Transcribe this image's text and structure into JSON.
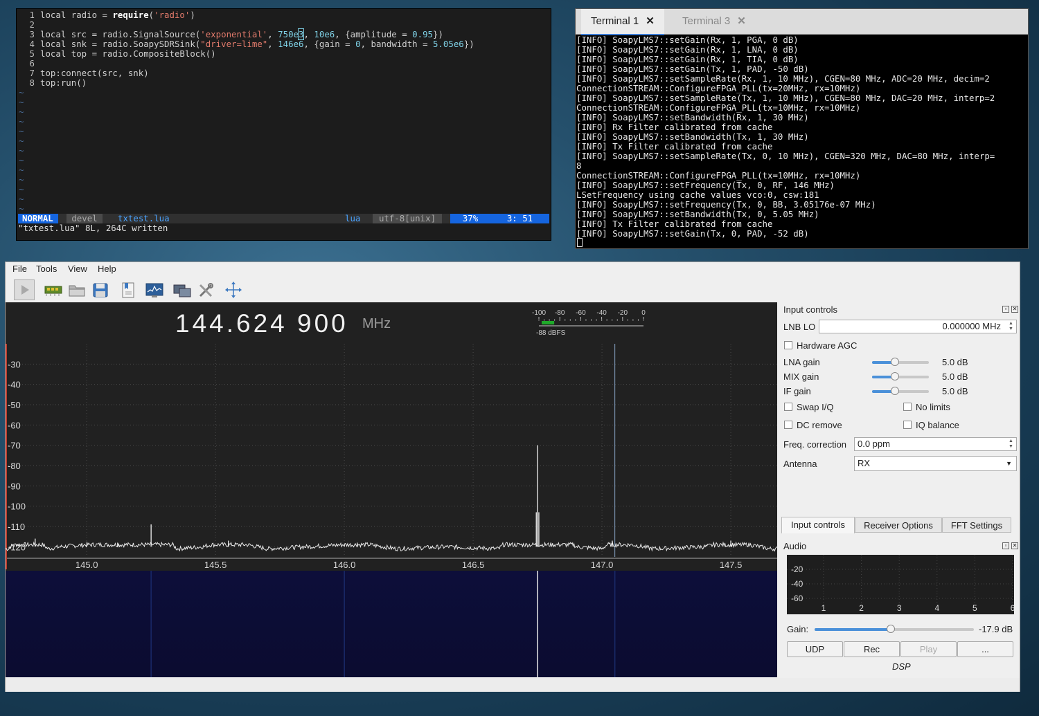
{
  "editor": {
    "lines": [
      {
        "n": "1"
      },
      {
        "n": "2"
      },
      {
        "n": "3"
      },
      {
        "n": "4"
      },
      {
        "n": "5"
      },
      {
        "n": "6"
      },
      {
        "n": "7"
      },
      {
        "n": "8"
      }
    ],
    "code": {
      "l1a": "local radio = ",
      "l1b": "require",
      "l1c": "(",
      "l1d": "'radio'",
      "l1e": ")",
      "l3a": "local src = radio.SignalSource(",
      "l3b": "'exponential'",
      "l3c": ", ",
      "l3d": "750e",
      "l3e": "3",
      "l3f": ", ",
      "l3g": "10e6",
      "l3h": ", {amplitude = ",
      "l3i": "0.95",
      "l3j": "})",
      "l4a": "local snk = radio.SoapySDRSink(",
      "l4b": "\"driver=lime\"",
      "l4c": ", ",
      "l4d": "146e6",
      "l4e": ", {gain = ",
      "l4f": "0",
      "l4g": ", bandwidth = ",
      "l4h": "5.05e6",
      "l4i": "})",
      "l5": "local top = radio.CompositeBlock()",
      "l7": "top:connect(src, snk)",
      "l8": "top:run()"
    },
    "tilde": "~",
    "status": {
      "mode": "NORMAL",
      "branch": "devel",
      "file": "txtest.lua",
      "filetype": "lua",
      "encoding": "utf-8[unix]",
      "percent": "37%",
      "pos": "3: 51"
    },
    "cmdline": "\"txtest.lua\" 8L, 264C written"
  },
  "terminal": {
    "tabs": [
      {
        "label": "Terminal 1"
      },
      {
        "label": "Terminal 3"
      }
    ],
    "lines": [
      "[INFO] SoapyLMS7::setGain(Rx, 1, PGA, 0 dB)",
      "[INFO] SoapyLMS7::setGain(Rx, 1, LNA, 0 dB)",
      "[INFO] SoapyLMS7::setGain(Rx, 1, TIA, 0 dB)",
      "[INFO] SoapyLMS7::setGain(Tx, 1, PAD, -50 dB)",
      "[INFO] SoapyLMS7::setSampleRate(Rx, 1, 10 MHz), CGEN=80 MHz, ADC=20 MHz, decim=2",
      "ConnectionSTREAM::ConfigureFPGA_PLL(tx=20MHz, rx=10MHz)",
      "[INFO] SoapyLMS7::setSampleRate(Tx, 1, 10 MHz), CGEN=80 MHz, DAC=20 MHz, interp=2",
      "ConnectionSTREAM::ConfigureFPGA_PLL(tx=10MHz, rx=10MHz)",
      "[INFO] SoapyLMS7::setBandwidth(Rx, 1, 30 MHz)",
      "[INFO] Rx Filter calibrated from cache",
      "[INFO] SoapyLMS7::setBandwidth(Tx, 1, 30 MHz)",
      "[INFO] Tx Filter calibrated from cache",
      "[INFO] SoapyLMS7::setSampleRate(Tx, 0, 10 MHz), CGEN=320 MHz, DAC=80 MHz, interp=",
      "8",
      "ConnectionSTREAM::ConfigureFPGA_PLL(tx=10MHz, rx=10MHz)",
      "[INFO] SoapyLMS7::setFrequency(Tx, 0, RF, 146 MHz)",
      "LSetFrequency using cache values vco:0, csw:181",
      "[INFO] SoapyLMS7::setFrequency(Tx, 0, BB, 3.05176e-07 MHz)",
      "[INFO] SoapyLMS7::setBandwidth(Tx, 0, 5.05 MHz)",
      "[INFO] Tx Filter calibrated from cache",
      "[INFO] SoapyLMS7::setGain(Tx, 0, PAD, -52 dB)"
    ]
  },
  "menu": [
    "File",
    "Tools",
    "View",
    "Help"
  ],
  "toolbar": [
    "play-icon",
    "sdr-device-icon",
    "open-folder-icon",
    "save-icon",
    "bookmark-icon",
    "fft-display-icon",
    "remote-control-icon",
    "tools-icon",
    "fullscreen-icon"
  ],
  "receiver": {
    "freq": "144.624 900",
    "unit": "MHz",
    "meter": {
      "ticks": [
        "-100",
        "-80",
        "-60",
        "-40",
        "-20",
        "0"
      ],
      "level": "-88 dBFS",
      "level_value": -88
    }
  },
  "chart_data": {
    "type": "line",
    "title": "",
    "xlabel": "",
    "ylabel": "",
    "x_ticks": [
      "145.0",
      "145.5",
      "146.0",
      "146.5",
      "147.0",
      "147.5"
    ],
    "y_ticks": [
      "-30",
      "-40",
      "-50",
      "-60",
      "-70",
      "-80",
      "-90",
      "-100",
      "-110",
      "-120"
    ],
    "xlim": [
      144.685,
      147.68
    ],
    "ylim": [
      -125,
      -20
    ],
    "grid": true,
    "series": [
      {
        "x": [
          144.7,
          144.8,
          144.85,
          144.9,
          145.0,
          145.12,
          145.25,
          145.35,
          145.45,
          145.55,
          145.7,
          145.85,
          146.0,
          146.05,
          146.2,
          146.4,
          146.6,
          146.745,
          146.75,
          146.755,
          146.9,
          147.0,
          147.04,
          147.2,
          147.4,
          147.5,
          147.65
        ],
        "values": [
          -120,
          -116,
          -121,
          -120,
          -119,
          -118,
          -109,
          -121,
          -120,
          -117,
          -121,
          -120,
          -119,
          -118,
          -121,
          -120,
          -121,
          -103,
          -70,
          -103,
          -120,
          -121,
          -117,
          -121,
          -120,
          -117,
          -121
        ]
      }
    ],
    "marker_freq": 147.05
  },
  "dock": {
    "input_title": "Input controls",
    "lnb_label": "LNB LO",
    "lnb_value": "0.000000 MHz",
    "agc": "Hardware AGC",
    "gains": [
      {
        "label": "LNA gain",
        "value": "5.0 dB",
        "pos": 0.4
      },
      {
        "label": "MIX gain",
        "value": "5.0 dB",
        "pos": 0.4
      },
      {
        "label": "IF gain",
        "value": "5.0 dB",
        "pos": 0.4
      }
    ],
    "swap": "Swap I/Q",
    "nolimits": "No limits",
    "dc": "DC remove",
    "iq": "IQ balance",
    "freqcorr_label": "Freq. correction",
    "freqcorr_value": "0.0 ppm",
    "antenna_label": "Antenna",
    "antenna_value": "RX",
    "tabs": [
      "Input controls",
      "Receiver Options",
      "FFT Settings"
    ],
    "audio_title": "Audio",
    "audio_y": [
      "-20",
      "-40",
      "-60"
    ],
    "audio_x": [
      "1",
      "2",
      "3",
      "4",
      "5",
      "6"
    ],
    "gain_label": "Gain:",
    "gain_value": "-17.9 dB",
    "gain_pos": 0.48,
    "buttons": [
      "UDP",
      "Rec",
      "Play",
      "..."
    ],
    "dsp": "DSP"
  }
}
